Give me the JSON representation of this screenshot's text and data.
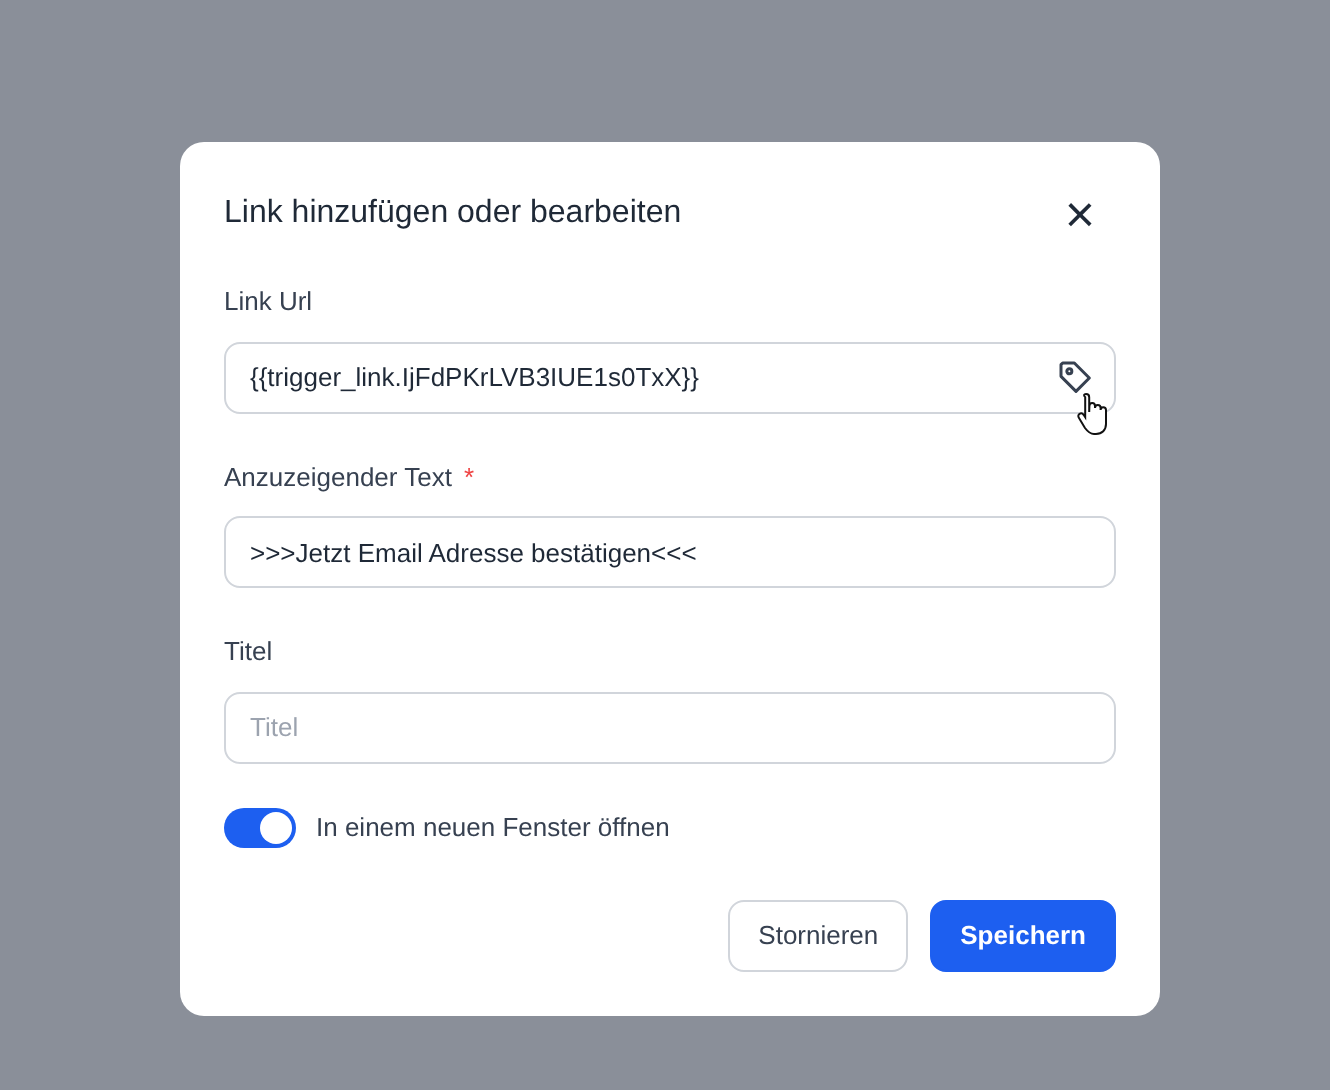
{
  "dialog": {
    "title": "Link hinzufügen oder bearbeiten",
    "close": "×"
  },
  "fields": [
    {
      "label": "Link Url",
      "value": "{{trigger_link.IjFdPKrLVB3IUE1s0TxX}}",
      "required": false,
      "kind": "tag"
    },
    {
      "label": "Anzuzeigender Text",
      "value": ">>>Jetzt Email Adresse bestätigen<<<",
      "required": true,
      "kind": "plain"
    },
    {
      "label": "Titel",
      "placeholder": "Titel",
      "required": false,
      "kind": "plain"
    }
  ],
  "required_mark": "*",
  "toggle": {
    "label": "In einem neuen Fenster öffnen",
    "on": true
  },
  "buttons": [
    {
      "label": "Stornieren",
      "kind": "secondary"
    },
    {
      "label": "Speichern",
      "kind": "primary"
    }
  ]
}
